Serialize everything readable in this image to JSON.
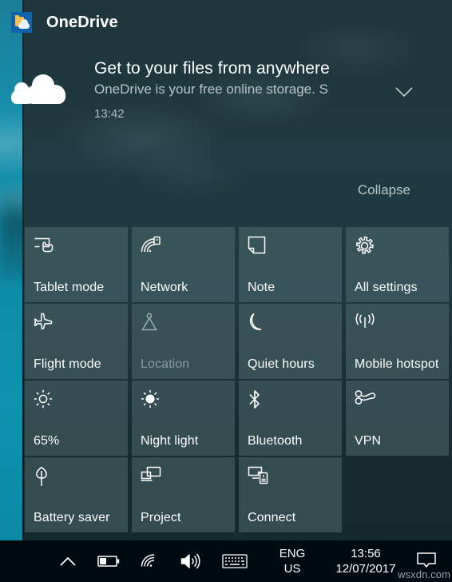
{
  "desktop": {
    "wallpaper_description": "teal underwater ocean photo"
  },
  "action_center": {
    "notification": {
      "app_name": "OneDrive",
      "app_icon": "onedrive-icon",
      "icon": "cloud-icon",
      "title": "Get to your files from anywhere",
      "message": "OneDrive is your free online storage. S",
      "time": "13:42",
      "expand_icon": "chevron-down-icon",
      "collapse_label": "Collapse"
    },
    "quick_actions": [
      {
        "label": "Tablet mode",
        "icon": "tablet-mode-icon",
        "state": "enabled"
      },
      {
        "label": "Network",
        "icon": "network-icon",
        "state": "enabled"
      },
      {
        "label": "Note",
        "icon": "note-icon",
        "state": "enabled"
      },
      {
        "label": "All settings",
        "icon": "gear-icon",
        "state": "enabled"
      },
      {
        "label": "Flight mode",
        "icon": "airplane-icon",
        "state": "enabled"
      },
      {
        "label": "Location",
        "icon": "location-pin-icon",
        "state": "disabled"
      },
      {
        "label": "Quiet hours",
        "icon": "moon-icon",
        "state": "enabled"
      },
      {
        "label": "Mobile hotspot",
        "icon": "hotspot-icon",
        "state": "enabled"
      },
      {
        "label": "65%",
        "icon": "brightness-icon",
        "state": "enabled"
      },
      {
        "label": "Night light",
        "icon": "night-light-icon",
        "state": "enabled"
      },
      {
        "label": "Bluetooth",
        "icon": "bluetooth-icon",
        "state": "enabled"
      },
      {
        "label": "VPN",
        "icon": "vpn-icon",
        "state": "enabled"
      },
      {
        "label": "Battery saver",
        "icon": "leaf-icon",
        "state": "enabled"
      },
      {
        "label": "Project",
        "icon": "project-icon",
        "state": "enabled"
      },
      {
        "label": "Connect",
        "icon": "connect-icon",
        "state": "enabled"
      }
    ]
  },
  "taskbar": {
    "tray_icons": [
      "chevron-up-icon",
      "battery-icon",
      "wifi-icon",
      "volume-icon",
      "keyboard-icon"
    ],
    "language": {
      "name": "ENG",
      "region": "US"
    },
    "clock": {
      "time": "13:56",
      "date": "12/07/2017"
    },
    "action_center_icon": "action-center-icon"
  },
  "watermark": "wsxdn.com",
  "colors": {
    "panel": "#1f3a40",
    "tile": "#60797e",
    "taskbar": "#010a10",
    "accent_onedrive": "#1161ad",
    "text_primary": "#ffffff",
    "text_secondary": "#b7c3c5",
    "text_disabled": "#8c9a9d"
  }
}
